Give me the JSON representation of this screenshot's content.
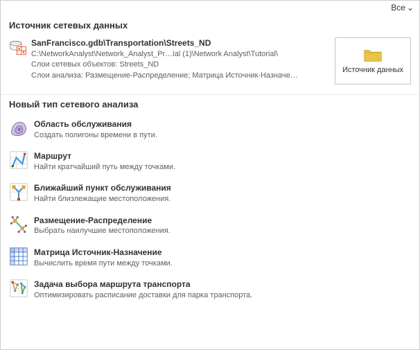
{
  "topbar": {
    "filter_label": "Все"
  },
  "data_source": {
    "header": "Источник сетевых данных",
    "title": "SanFrancisco.gdb\\Transportation\\Streets_ND",
    "path": "C:\\NetworkAnalyst\\Network_Analyst_Pr…ial (1)\\Network Analyst\\Tutorial\\",
    "layers": "Слои сетевых объектов: Streets_ND",
    "analysis": "Слои анализа: Размещение-Распределение; Матрица Источник-Назначе…",
    "button_label": "Источник данных"
  },
  "analysis_section": {
    "header": "Новый тип сетевого анализа",
    "items": [
      {
        "title": "Область обслуживания",
        "desc": "Создать полигоны времени в пути."
      },
      {
        "title": "Маршрут",
        "desc": "Найти кратчайший путь между точками."
      },
      {
        "title": "Ближайший пункт обслуживания",
        "desc": "Найти близлежащие местоположения."
      },
      {
        "title": "Размещение-Распределение",
        "desc": "Выбрать наилучшие местоположения."
      },
      {
        "title": "Матрица Источник-Назначение",
        "desc": "Вычислить время пути между точками."
      },
      {
        "title": "Задача выбора маршрута транспорта",
        "desc": "Оптимизировать расписание доставки для парка транспорта."
      }
    ]
  }
}
